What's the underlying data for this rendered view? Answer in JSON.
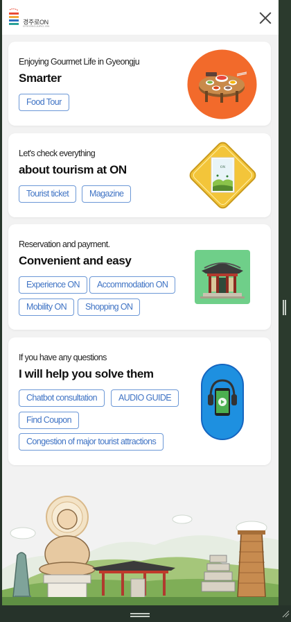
{
  "header": {
    "logo_text": "경주로ON",
    "logo_subtext": "GYEONGJURO-ON"
  },
  "cards": [
    {
      "subtitle": "Enjoying Gourmet Life in Gyeongju",
      "title": "Smarter",
      "tags": [
        "Food Tour"
      ],
      "icon": "food-table-icon"
    },
    {
      "subtitle": "Let's check everything",
      "title": "about tourism at ON",
      "tags": [
        "Tourist ticket",
        "Magazine"
      ],
      "icon": "tourism-sign-icon"
    },
    {
      "subtitle": "Reservation and payment.",
      "title": "Convenient and easy",
      "tags": [
        "Experience ON",
        "Accommodation ON",
        "Mobility ON",
        "Shopping ON"
      ],
      "icon": "hanok-gate-icon"
    },
    {
      "subtitle": "If you have any questions",
      "title": "I will help you solve them",
      "tags": [
        "Chatbot consultation",
        "AUDIO GUIDE",
        "Find Coupon",
        "Congestion of major tourist attractions"
      ],
      "icon": "audio-guide-phone-icon"
    }
  ],
  "colors": {
    "tag_border": "#6b97d6",
    "tag_text": "#3f73c4",
    "food_circle": "#f26a2b",
    "sign_yellow": "#f3c53a",
    "gate_green": "#6fcf89",
    "audio_blue": "#1e90e0"
  }
}
